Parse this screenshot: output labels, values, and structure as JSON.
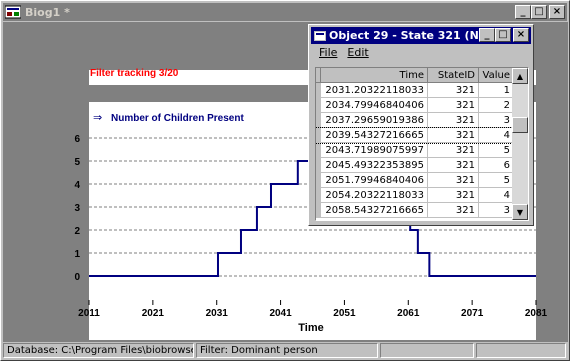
{
  "main_window": {
    "title": "Biog1 *",
    "minimize": "_",
    "maximize": "□",
    "close": "×"
  },
  "chart": {
    "filter_text": "Filter tracking 3/20",
    "arrow_glyph": "⇒",
    "series_title": "Number of Children Present",
    "xlabel": "Time",
    "colors": {
      "filter_text": "#ff0000",
      "series_title": "#000080",
      "line": "#000080",
      "band": "#808080"
    }
  },
  "chart_data": {
    "type": "line",
    "series": [
      {
        "values": [
          [
            2011,
            0
          ],
          [
            2031.2,
            0
          ],
          [
            2031.2,
            1
          ],
          [
            2034.8,
            1
          ],
          [
            2034.8,
            2
          ],
          [
            2037.3,
            2
          ],
          [
            2037.3,
            3
          ],
          [
            2039.5,
            3
          ],
          [
            2039.5,
            4
          ],
          [
            2043.7,
            4
          ],
          [
            2043.7,
            5
          ],
          [
            2045.5,
            5
          ],
          [
            2045.5,
            6
          ],
          [
            2061.3,
            6
          ],
          [
            2061.3,
            2
          ],
          [
            2062.5,
            2
          ],
          [
            2062.5,
            1
          ],
          [
            2064.3,
            1
          ],
          [
            2064.3,
            0
          ],
          [
            2081,
            0
          ]
        ]
      }
    ],
    "xlabel": "Time",
    "xlim": [
      2011,
      2081
    ],
    "ylim": [
      -1,
      6.5
    ],
    "x_ticks": [
      "2011",
      "2021",
      "2031",
      "2041",
      "2051",
      "2061",
      "2071",
      "2081"
    ],
    "y_ticks": [
      "0",
      "1",
      "2",
      "3",
      "4",
      "5",
      "6"
    ],
    "grid": true
  },
  "object_window": {
    "title": "Object 29 - State 321 (N...",
    "menu": [
      {
        "label": "File",
        "accel_index": 0
      },
      {
        "label": "Edit",
        "accel_index": 0
      }
    ],
    "columns": [
      "Time",
      "StateID",
      "Value"
    ],
    "rows": [
      [
        "2031.20322118033",
        "321",
        "1"
      ],
      [
        "2034.79946840406",
        "321",
        "2"
      ],
      [
        "2037.29659019386",
        "321",
        "3"
      ],
      [
        "2039.54327216665",
        "321",
        "4"
      ],
      [
        "2043.71989075997",
        "321",
        "5"
      ],
      [
        "2045.49322353895",
        "321",
        "6"
      ],
      [
        "2051.79946840406",
        "321",
        "5"
      ],
      [
        "2054.20322118033",
        "321",
        "4"
      ],
      [
        "2058.54327216665",
        "321",
        "3"
      ]
    ],
    "selected_row_index": 3
  },
  "status_bar": {
    "database": "Database: C:\\Program Files\\biobrowse\\",
    "filter": "Filter: Dominant person",
    "cell3": "",
    "cell4": ""
  }
}
